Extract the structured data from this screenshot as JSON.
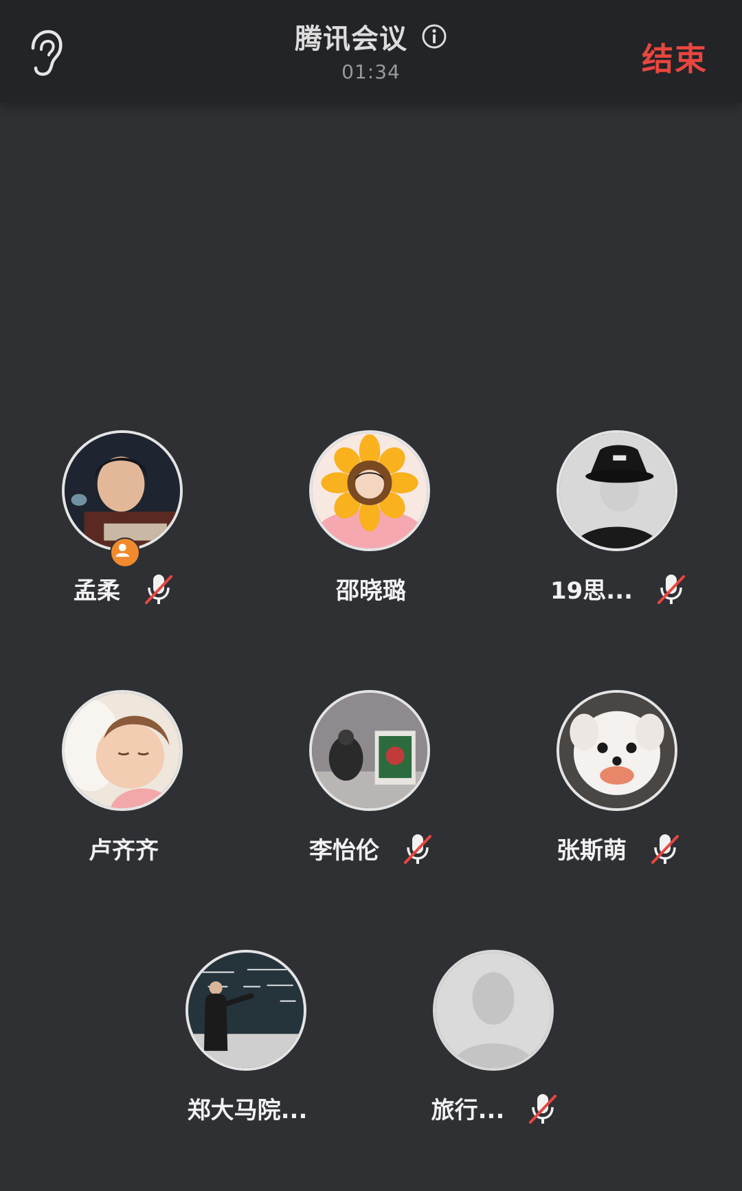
{
  "header": {
    "title": "腾讯会议",
    "timer": "01:34",
    "end_label": "结束"
  },
  "participants": [
    {
      "name": "孟柔",
      "muted": true,
      "host": true,
      "avatar": "dark-room-photo"
    },
    {
      "name": "邵晓璐",
      "muted": false,
      "host": false,
      "avatar": "sunflower-cartoon"
    },
    {
      "name": "19思...",
      "muted": true,
      "host": false,
      "avatar": "bucket-hat-photo"
    },
    {
      "name": "卢齐齐",
      "muted": false,
      "host": false,
      "avatar": "sleeping-baby-photo"
    },
    {
      "name": "李怡伦",
      "muted": true,
      "host": false,
      "avatar": "gallery-photo"
    },
    {
      "name": "张斯萌",
      "muted": true,
      "host": false,
      "avatar": "white-dog-photo"
    },
    {
      "name": "郑大马院...",
      "muted": false,
      "host": false,
      "avatar": "blackboard-teacher-photo"
    },
    {
      "name": "旅行...",
      "muted": true,
      "host": false,
      "avatar": "default-person"
    }
  ],
  "colors": {
    "background": "#2e3034",
    "header": "#232427",
    "end": "#e9463f",
    "host_badge": "#f08a2c",
    "mute_slash": "#e9463f"
  },
  "icons": [
    "ear-icon",
    "info-icon",
    "mic-off-icon",
    "host-icon"
  ]
}
